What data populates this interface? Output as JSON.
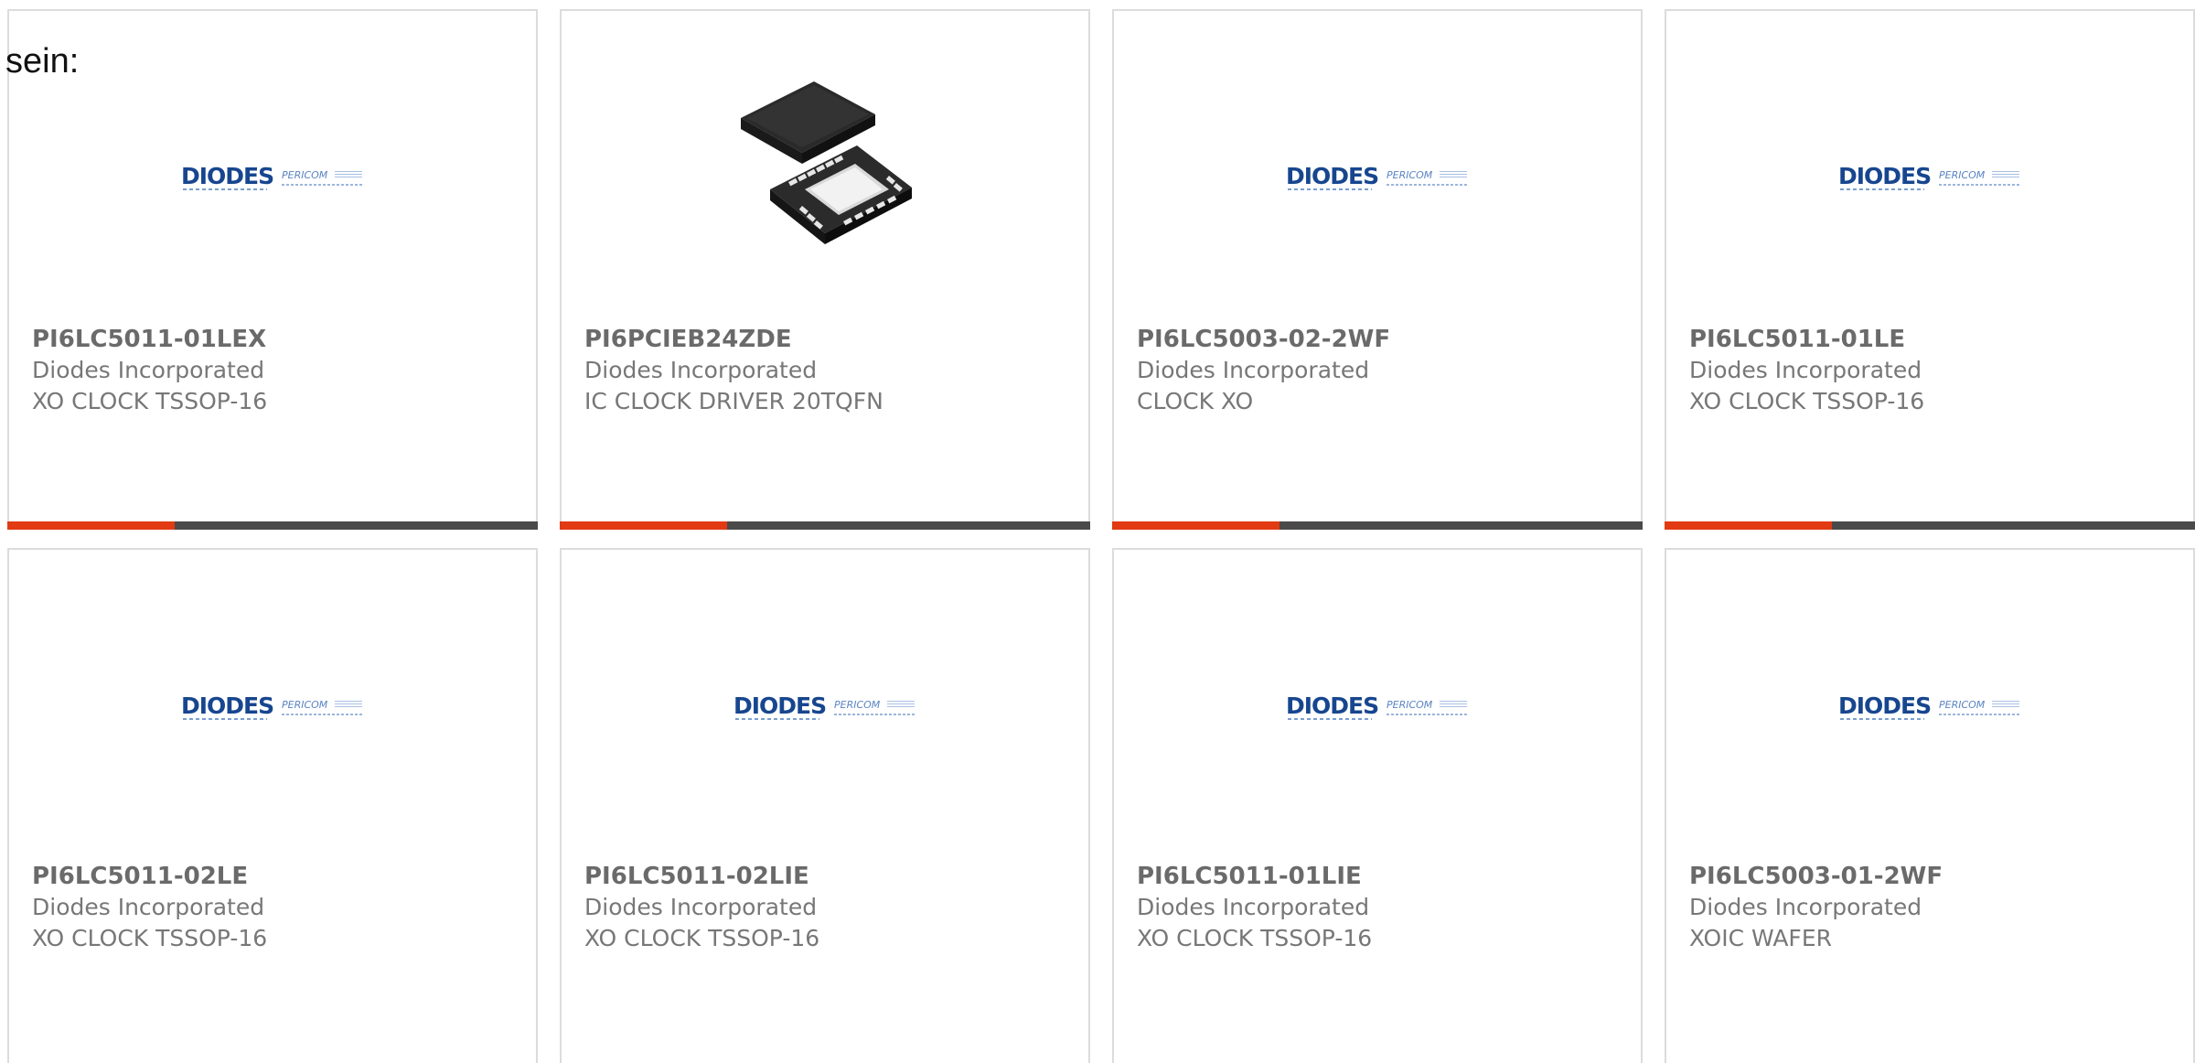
{
  "intro_text": "sein:",
  "brand_logo": {
    "primary": "DIODES",
    "secondary": "PERICOM"
  },
  "colors": {
    "accent_bar": "#e23a12",
    "bar_base": "#4a4a4a",
    "logo_primary": "#17468f",
    "card_border": "#dcdcdc"
  },
  "products": [
    {
      "part": "PI6LC5011-01LEX",
      "manufacturer": "Diodes Incorporated",
      "description": "XO CLOCK TSSOP-16",
      "image": "diodes-pericom-logo"
    },
    {
      "part": "PI6PCIEB24ZDE",
      "manufacturer": "Diodes Incorporated",
      "description": "IC CLOCK DRIVER 20TQFN",
      "image": "qfn-chip-photo"
    },
    {
      "part": "PI6LC5003-02-2WF",
      "manufacturer": "Diodes Incorporated",
      "description": "CLOCK XO",
      "image": "diodes-pericom-logo"
    },
    {
      "part": "PI6LC5011-01LE",
      "manufacturer": "Diodes Incorporated",
      "description": "XO CLOCK TSSOP-16",
      "image": "diodes-pericom-logo"
    },
    {
      "part": "PI6LC5011-02LE",
      "manufacturer": "Diodes Incorporated",
      "description": "XO CLOCK TSSOP-16",
      "image": "diodes-pericom-logo"
    },
    {
      "part": "PI6LC5011-02LIE",
      "manufacturer": "Diodes Incorporated",
      "description": "XO CLOCK TSSOP-16",
      "image": "diodes-pericom-logo"
    },
    {
      "part": "PI6LC5011-01LIE",
      "manufacturer": "Diodes Incorporated",
      "description": "XO CLOCK TSSOP-16",
      "image": "diodes-pericom-logo"
    },
    {
      "part": "PI6LC5003-01-2WF",
      "manufacturer": "Diodes Incorporated",
      "description": "XOIC WAFER",
      "image": "diodes-pericom-logo"
    }
  ]
}
